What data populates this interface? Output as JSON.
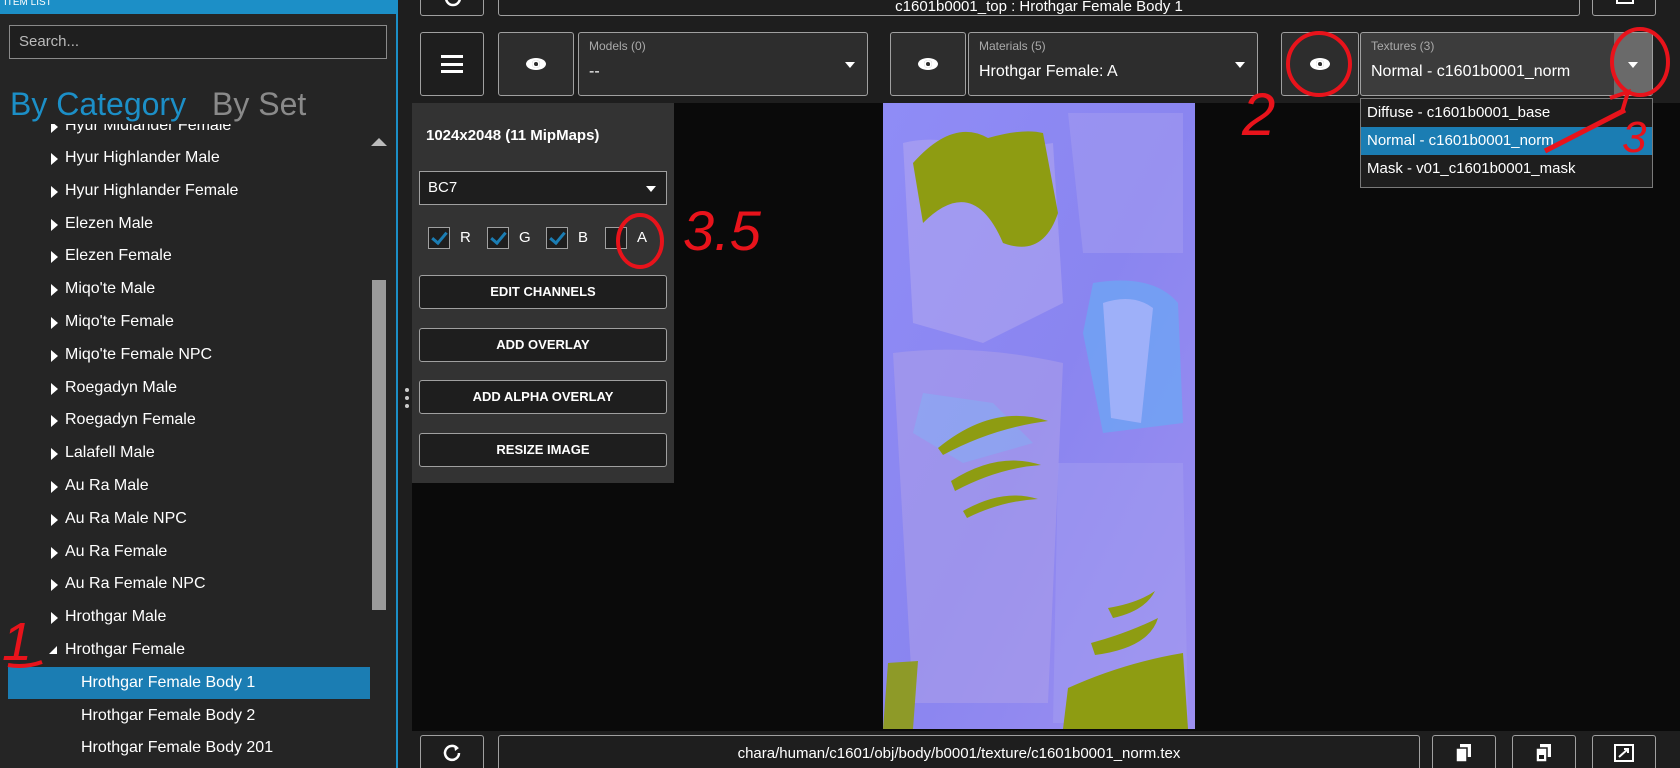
{
  "left_panel": {
    "header": "ITEM LIST",
    "search_placeholder": "Search...",
    "tabs": [
      "By Category",
      "By Set"
    ],
    "partial_top_item": "Hyur Midlander Female",
    "categories": [
      "Hyur Highlander Male",
      "Hyur Highlander Female",
      "Elezen Male",
      "Elezen Female",
      "Miqo'te Male",
      "Miqo'te Female",
      "Miqo'te Female NPC",
      "Roegadyn Male",
      "Roegadyn Female",
      "Lalafell Male",
      "Au Ra Male",
      "Au Ra Male NPC",
      "Au Ra Female",
      "Au Ra Female NPC",
      "Hrothgar Male",
      "Hrothgar Female"
    ],
    "expanded_category": "Hrothgar Female",
    "children": [
      "Hrothgar Female Body 1",
      "Hrothgar Female Body 2",
      "Hrothgar Female Body 201"
    ],
    "selected_child": "Hrothgar Female Body 1"
  },
  "top_bar": {
    "title": "c1601b0001_top : Hrothgar Female Body 1"
  },
  "selectors": {
    "models": {
      "caption": "Models (0)",
      "value": "--"
    },
    "materials": {
      "caption": "Materials (5)",
      "value": "Hrothgar Female: A"
    },
    "textures": {
      "caption": "Textures (3)",
      "value": "Normal - c1601b0001_norm"
    }
  },
  "texture_options": [
    "Diffuse - c1601b0001_base",
    "Normal - c1601b0001_norm",
    "Mask - v01_c1601b0001_mask"
  ],
  "selected_texture_option": "Normal - c1601b0001_norm",
  "tool_panel": {
    "dimensions": "1024x2048 (11 MipMaps)",
    "format": "BC7",
    "channels": [
      {
        "label": "R",
        "checked": true
      },
      {
        "label": "G",
        "checked": true
      },
      {
        "label": "B",
        "checked": true
      },
      {
        "label": "A",
        "checked": false
      }
    ],
    "buttons": [
      "EDIT CHANNELS",
      "ADD OVERLAY",
      "ADD ALPHA OVERLAY",
      "RESIZE IMAGE"
    ]
  },
  "bottom_bar": {
    "path": "chara/human/c1601/obj/body/b0001/texture/c1601b0001_norm.tex"
  },
  "annotations": [
    "1",
    "2",
    "3",
    "3.5"
  ],
  "colors": {
    "accent": "#1c8fc7",
    "selection": "#1b7db3",
    "annotation": "#e8131b",
    "normal_map": "#8a85f0",
    "fur": "#8e9c12"
  },
  "icons": [
    "refresh-icon",
    "menu-icon",
    "eye-icon",
    "copy-icon",
    "external-icon",
    "chevron-down-icon"
  ]
}
